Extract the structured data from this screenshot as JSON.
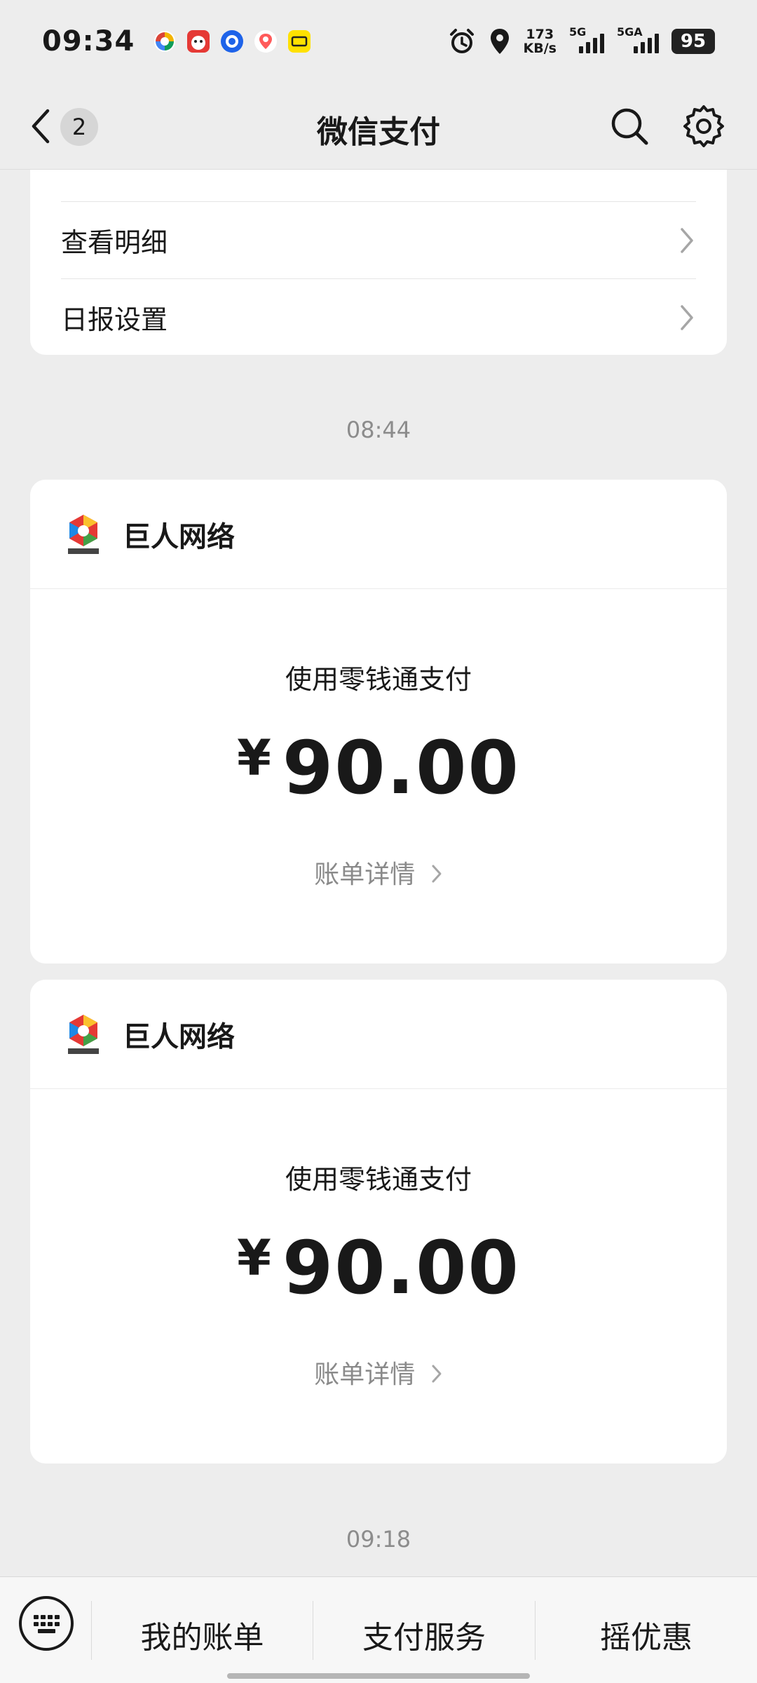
{
  "status_bar": {
    "time": "09:34",
    "net_speed_value": "173",
    "net_speed_unit": "KB/s",
    "sim1_label": "5G",
    "sim2_label": "5GA",
    "battery": "95"
  },
  "nav": {
    "badge_count": "2",
    "title": "微信支付"
  },
  "menu": {
    "items": [
      {
        "label": "查看明细"
      },
      {
        "label": "日报设置"
      }
    ]
  },
  "timeline": {
    "time1": "08:44",
    "time2": "09:18"
  },
  "payments": [
    {
      "merchant": "巨人网络",
      "method": "使用零钱通支付",
      "currency": "¥",
      "amount": "90.00",
      "detail_link": "账单详情"
    },
    {
      "merchant": "巨人网络",
      "method": "使用零钱通支付",
      "currency": "¥",
      "amount": "90.00",
      "detail_link": "账单详情"
    }
  ],
  "bottom_tabs": [
    {
      "label": "我的账单"
    },
    {
      "label": "支付服务"
    },
    {
      "label": "摇优惠"
    }
  ],
  "colors": {
    "background": "#ededed",
    "card": "#ffffff",
    "text_primary": "#191919",
    "text_secondary": "#8a8a8a"
  }
}
